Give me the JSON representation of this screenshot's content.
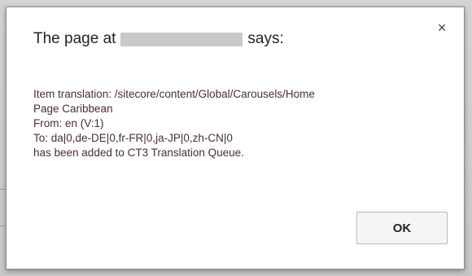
{
  "dialog": {
    "title_prefix": "The page at",
    "title_suffix": "says:",
    "close_glyph": "×",
    "message_lines": [
      "Item translation: /sitecore/content/Global/Carousels/Home",
      "Page Caribbean",
      "From: en (V:1)",
      "To: da|0,de-DE|0,fr-FR|0,ja-JP|0,zh-CN|0",
      "has been added to CT3 Translation Queue."
    ],
    "ok_label": "OK"
  },
  "colors": {
    "message_text": "#4a2e2e",
    "title_text": "#222222",
    "dialog_border": "#8a8a8a"
  }
}
